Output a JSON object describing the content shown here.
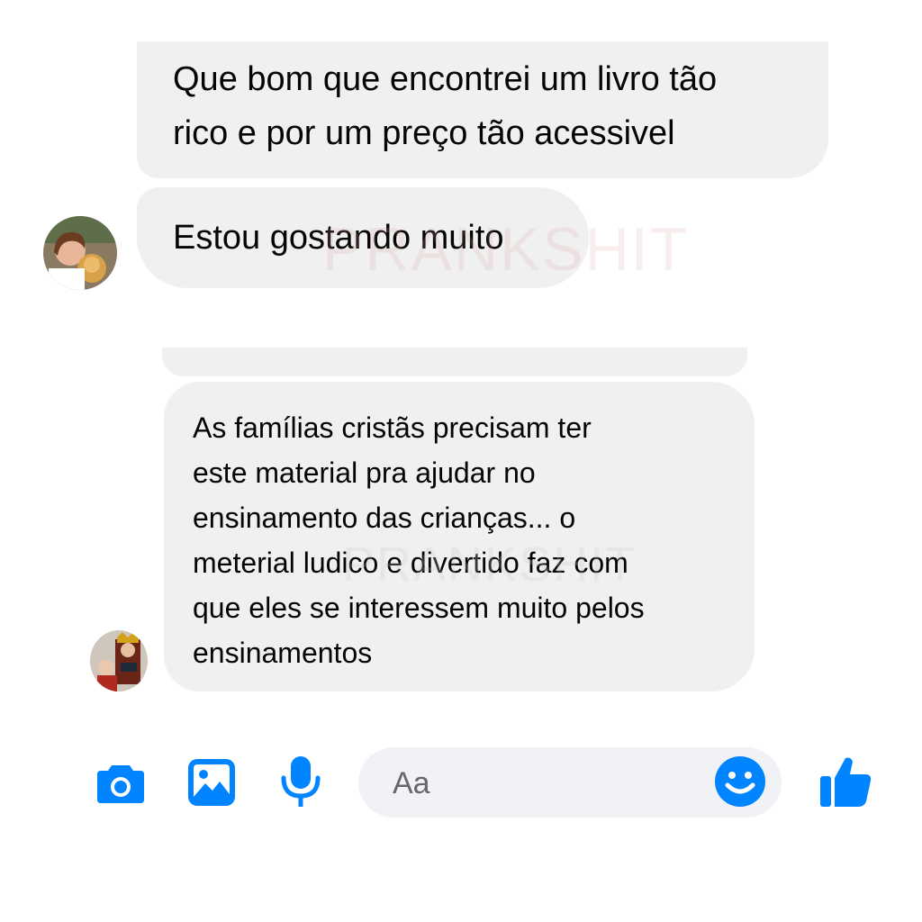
{
  "messages": [
    {
      "text": "Que bom que encontrei um livro tão\nrico e por um preço tão acessivel"
    },
    {
      "text": "Estou gostando muito"
    },
    {
      "text": "As famílias cristãs precisam ter\neste material pra ajudar no\nensinamento das crianças... o\nmeterial ludico e divertido faz com\nque eles se interessem muito pelos\nensinamentos"
    }
  ],
  "watermark": "PRANKSHIT",
  "composer": {
    "placeholder": "Aa",
    "icons": [
      "camera-icon",
      "image-icon",
      "microphone-icon",
      "emoji-icon",
      "thumbs-up-icon"
    ]
  },
  "colors": {
    "bubble": "#f0f0f0",
    "accent": "#0084ff",
    "input_bg": "#f0f2f5"
  }
}
